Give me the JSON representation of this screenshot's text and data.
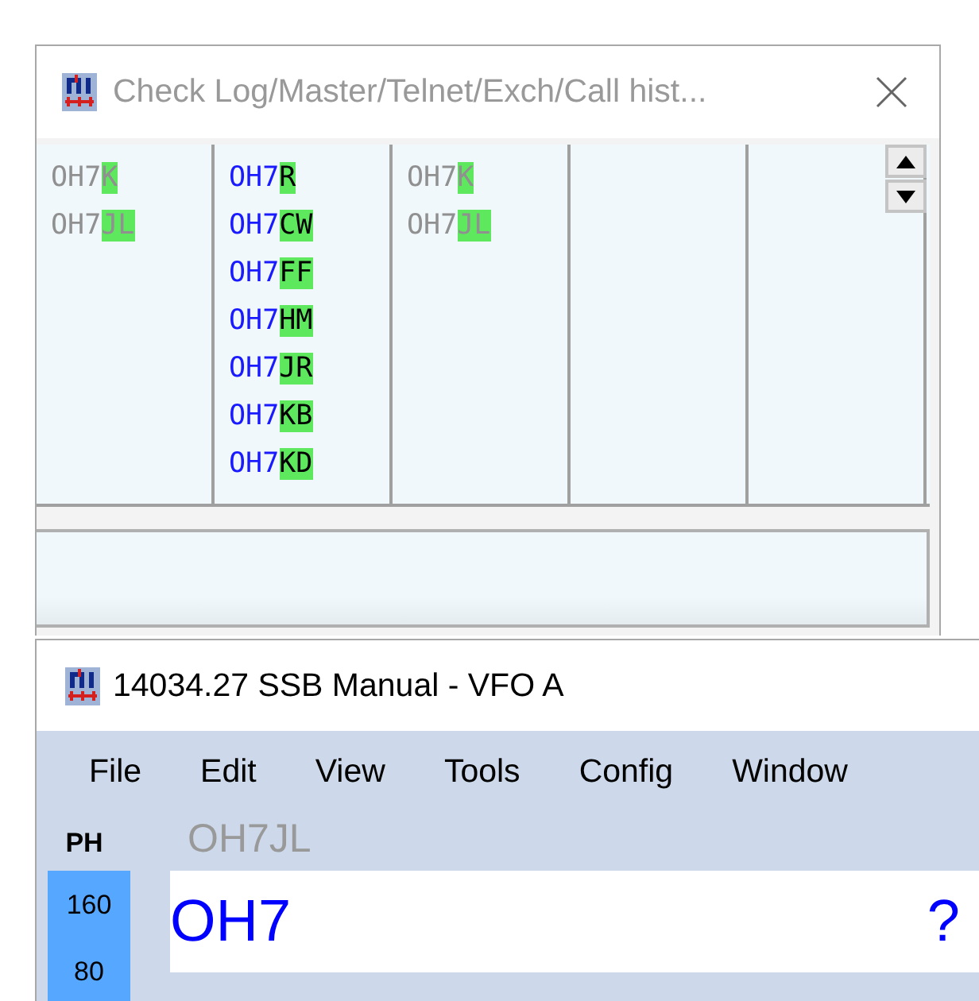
{
  "check_window": {
    "title": "Check Log/Master/Telnet/Exch/Call hist...",
    "active": false,
    "columns": [
      {
        "kind": "log",
        "entries": [
          {
            "match": "OH7",
            "rest": "K"
          },
          {
            "match": "OH7",
            "rest": "JL"
          }
        ]
      },
      {
        "kind": "master",
        "entries": [
          {
            "match": "OH7",
            "rest": "R"
          },
          {
            "match": "OH7",
            "rest": "CW"
          },
          {
            "match": "OH7",
            "rest": "FF"
          },
          {
            "match": "OH7",
            "rest": "HM"
          },
          {
            "match": "OH7",
            "rest": "JR"
          },
          {
            "match": "OH7",
            "rest": "KB"
          },
          {
            "match": "OH7",
            "rest": "KD"
          }
        ]
      },
      {
        "kind": "log",
        "entries": [
          {
            "match": "OH7",
            "rest": "K"
          },
          {
            "match": "OH7",
            "rest": "JL"
          }
        ]
      },
      {
        "kind": "log"
      },
      {
        "kind": "log"
      }
    ]
  },
  "main_window": {
    "title": "14034.27 SSB Manual - VFO A",
    "active": true,
    "menu": [
      "File",
      "Edit",
      "View",
      "Tools",
      "Config",
      "Window"
    ],
    "mode": "PH",
    "previous_call": "OH7JL",
    "bands": [
      "160",
      "80"
    ],
    "call_field": {
      "value": "OH7",
      "status": "?"
    }
  }
}
